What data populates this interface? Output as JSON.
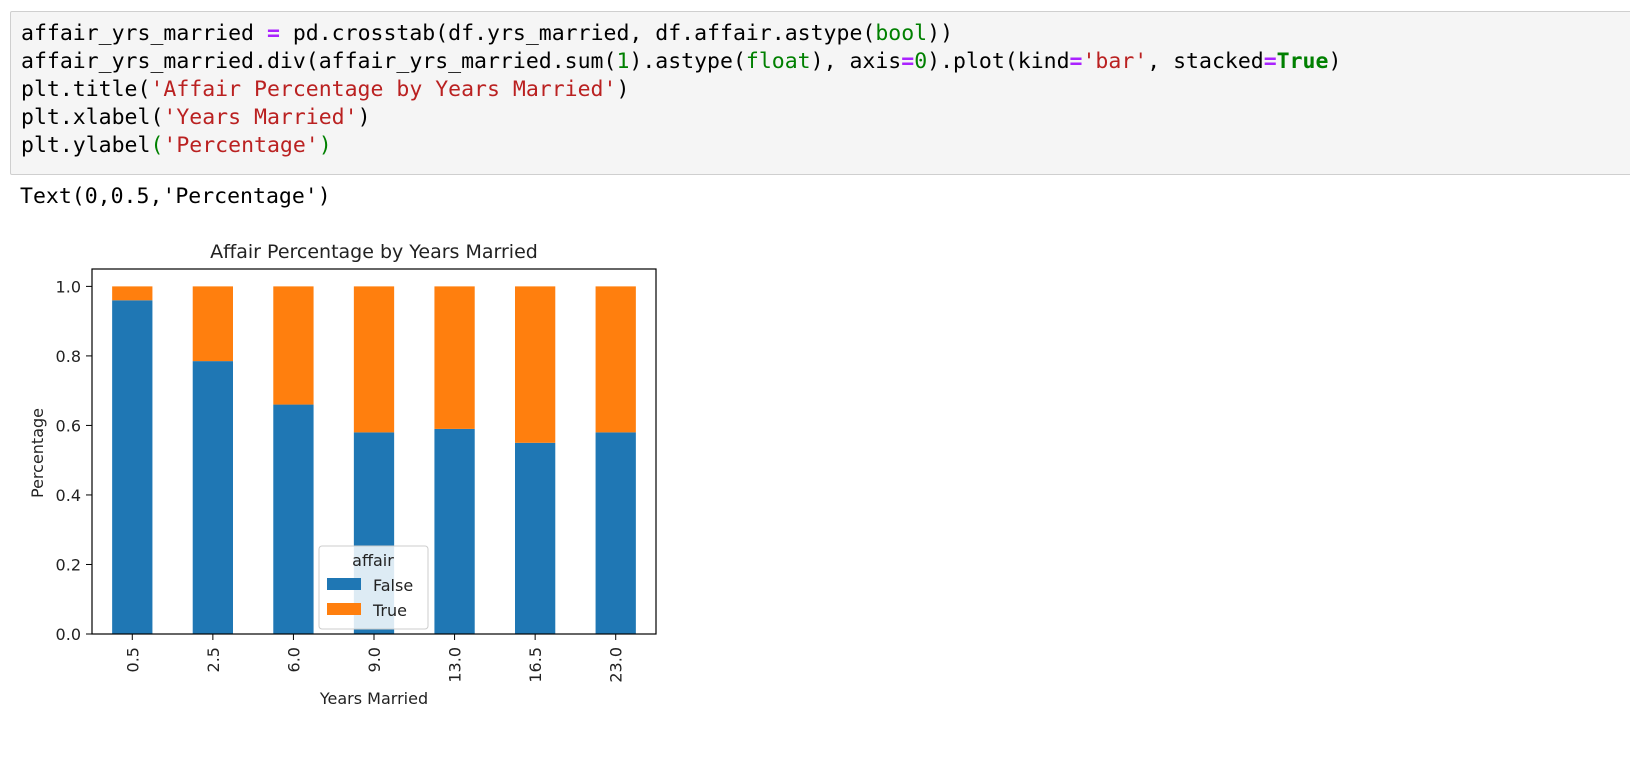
{
  "code_lines": [
    [
      [
        "affair_yrs_married ",
        ""
      ],
      [
        "=",
        "op"
      ],
      [
        " pd.crosstab(df.yrs_married, df.affair.astype(",
        ""
      ],
      [
        "bool",
        "bi"
      ],
      [
        "))",
        ""
      ]
    ],
    [
      [
        "affair_yrs_married.div(affair_yrs_married.sum(",
        ""
      ],
      [
        "1",
        "num"
      ],
      [
        ").astype(",
        ""
      ],
      [
        "float",
        "bi"
      ],
      [
        "), axis",
        ""
      ],
      [
        "=",
        "op"
      ],
      [
        "0",
        "num"
      ],
      [
        ").plot(kind",
        ""
      ],
      [
        "=",
        "op"
      ],
      [
        "'bar'",
        "str"
      ],
      [
        ", stacked",
        ""
      ],
      [
        "=",
        "op"
      ],
      [
        "True",
        "kw"
      ],
      [
        ")",
        ""
      ]
    ],
    [
      [
        "plt.title(",
        ""
      ],
      [
        "'Affair Percentage by Years Married'",
        "str"
      ],
      [
        ")",
        ""
      ]
    ],
    [
      [
        "plt.xlabel(",
        ""
      ],
      [
        "'Years Married'",
        "str"
      ],
      [
        ")",
        ""
      ]
    ],
    [
      [
        "plt.ylabel",
        ""
      ],
      [
        "(",
        "bi"
      ],
      [
        "'Percentage'",
        "str"
      ],
      [
        ")",
        "bi"
      ]
    ]
  ],
  "output_text": "Text(0,0.5,'Percentage')",
  "chart_data": {
    "type": "bar",
    "stacked": true,
    "title": "Affair Percentage by Years Married",
    "xlabel": "Years Married",
    "ylabel": "Percentage",
    "categories": [
      "0.5",
      "2.5",
      "6.0",
      "9.0",
      "13.0",
      "16.5",
      "23.0"
    ],
    "series": [
      {
        "name": "False",
        "color": "#1f77b4",
        "values": [
          0.96,
          0.785,
          0.66,
          0.58,
          0.59,
          0.55,
          0.58
        ]
      },
      {
        "name": "True",
        "color": "#ff7f0e",
        "values": [
          0.04,
          0.215,
          0.34,
          0.42,
          0.41,
          0.45,
          0.42
        ]
      }
    ],
    "ylim": [
      0,
      1.05
    ],
    "yticks": [
      "0.0",
      "0.2",
      "0.4",
      "0.6",
      "0.8",
      "1.0"
    ],
    "legend": {
      "title": "affair",
      "placement": "lower-center"
    },
    "grid": false
  }
}
